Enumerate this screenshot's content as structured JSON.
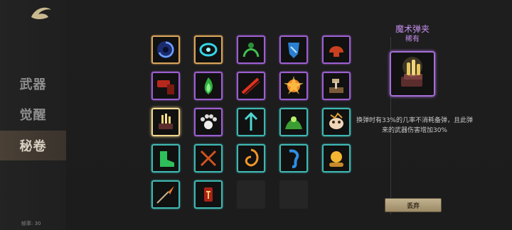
{
  "sidebar": {
    "items": [
      {
        "label": "武器",
        "active": false
      },
      {
        "label": "觉醒",
        "active": false
      },
      {
        "label": "秘卷",
        "active": true
      }
    ],
    "fps_label": "帧率: 30"
  },
  "grid": {
    "slots": [
      {
        "icon": "vortex-orb-icon",
        "rarity": "gold"
      },
      {
        "icon": "cyan-ring-icon",
        "rarity": "gold"
      },
      {
        "icon": "green-figure-icon",
        "rarity": "purple"
      },
      {
        "icon": "blue-shield-icon",
        "rarity": "purple"
      },
      {
        "icon": "red-helmet-icon",
        "rarity": "purple"
      },
      {
        "icon": "red-hammer-icon",
        "rarity": "purple"
      },
      {
        "icon": "green-flame-icon",
        "rarity": "purple"
      },
      {
        "icon": "red-blade-icon",
        "rarity": "purple"
      },
      {
        "icon": "fire-burst-icon",
        "rarity": "purple"
      },
      {
        "icon": "anvil-hammer-icon",
        "rarity": "purple"
      },
      {
        "icon": "magic-magazine-icon",
        "rarity": "selected"
      },
      {
        "icon": "white-paw-icon",
        "rarity": "purple"
      },
      {
        "icon": "cyan-trident-icon",
        "rarity": "cyan"
      },
      {
        "icon": "green-aura-icon",
        "rarity": "cyan"
      },
      {
        "icon": "mask-face-icon",
        "rarity": "cyan"
      },
      {
        "icon": "green-boot-icon",
        "rarity": "cyan"
      },
      {
        "icon": "crossed-swords-icon",
        "rarity": "cyan"
      },
      {
        "icon": "orange-swirl-icon",
        "rarity": "cyan"
      },
      {
        "icon": "blue-scroll-icon",
        "rarity": "cyan"
      },
      {
        "icon": "gold-coin-pile-icon",
        "rarity": "cyan"
      },
      {
        "icon": "spear-tip-icon",
        "rarity": "cyan"
      },
      {
        "icon": "red-rune-icon",
        "rarity": "cyan"
      },
      {
        "icon": "empty-slot",
        "rarity": "empty"
      },
      {
        "icon": "empty-slot",
        "rarity": "empty"
      }
    ]
  },
  "detail": {
    "title": "魔术弹夹",
    "rarity": "稀有",
    "icon": "magic-magazine-icon",
    "description_line1": "换弹时有33%的几率不消耗备弹，且此弹",
    "description_line2": "来的武器伤害增加30%",
    "discard_label": "丢弃"
  },
  "colors": {
    "gold": "#d8a45a",
    "purple": "#9b5fd0",
    "cyan": "#3fb7b2",
    "title_purple": "#c691f0"
  }
}
